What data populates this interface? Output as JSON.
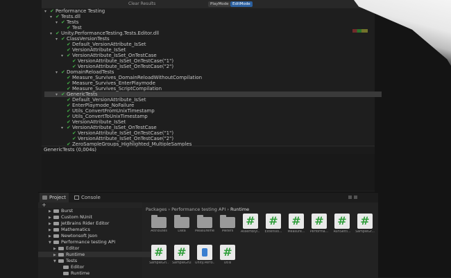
{
  "toolbar": {
    "clear_results": "Clear Results",
    "mode_play": "PlayMode",
    "mode_edit": "EditMode"
  },
  "tests": [
    {
      "label": "Performance Testing",
      "indent": 0,
      "arrow": true,
      "check": true
    },
    {
      "label": "Tests.dll",
      "indent": 1,
      "arrow": true,
      "check": true
    },
    {
      "label": "Tests",
      "indent": 2,
      "arrow": true,
      "check": true
    },
    {
      "label": "Test",
      "indent": 3,
      "arrow": false,
      "check": true
    },
    {
      "label": "Unity.PerformanceTesting.Tests.Editor.dll",
      "indent": 1,
      "arrow": true,
      "check": true
    },
    {
      "label": "ClassVersionTests",
      "indent": 2,
      "arrow": true,
      "check": true
    },
    {
      "label": "Default_VersionAttribute_IsSet",
      "indent": 3,
      "arrow": false,
      "check": true
    },
    {
      "label": "VersionAttribute_IsSet",
      "indent": 3,
      "arrow": false,
      "check": true
    },
    {
      "label": "VersionAttribute_IsSet_OnTestCase",
      "indent": 3,
      "arrow": true,
      "check": true
    },
    {
      "label": "VersionAttribute_IsSet_OnTestCase(\"1\")",
      "indent": 4,
      "arrow": false,
      "check": true
    },
    {
      "label": "VersionAttribute_IsSet_OnTestCase(\"2\")",
      "indent": 4,
      "arrow": false,
      "check": true
    },
    {
      "label": "DomainReloadTests",
      "indent": 2,
      "arrow": true,
      "check": true
    },
    {
      "label": "Measure_Survives_DomainReloadWithoutCompilation",
      "indent": 3,
      "arrow": false,
      "check": true
    },
    {
      "label": "Measure_Survives_EnterPlaymode",
      "indent": 3,
      "arrow": false,
      "check": true
    },
    {
      "label": "Measure_Survives_ScriptCompilation",
      "indent": 3,
      "arrow": false,
      "check": true
    },
    {
      "label": "GenericTests",
      "indent": 2,
      "arrow": true,
      "check": true,
      "selected": true
    },
    {
      "label": "Default_VersionAttribute_IsSet",
      "indent": 3,
      "arrow": false,
      "check": true
    },
    {
      "label": "EnterPlaymode_NoFailure",
      "indent": 3,
      "arrow": false,
      "check": true
    },
    {
      "label": "Utils_ConvertFromUnixTimestamp",
      "indent": 3,
      "arrow": false,
      "check": true
    },
    {
      "label": "Utils_ConvertToUnixTimestamp",
      "indent": 3,
      "arrow": false,
      "check": true
    },
    {
      "label": "VersionAttribute_IsSet",
      "indent": 3,
      "arrow": false,
      "check": true
    },
    {
      "label": "VersionAttribute_IsSet_OnTestCase",
      "indent": 3,
      "arrow": true,
      "check": true
    },
    {
      "label": "VersionAttribute_IsSet_OnTestCase(\"1\")",
      "indent": 4,
      "arrow": false,
      "check": true
    },
    {
      "label": "VersionAttribute_IsSet_OnTestCase(\"2\")",
      "indent": 4,
      "arrow": false,
      "check": true
    },
    {
      "label": "ZeroSampleGroups_Highlighted_MultipleSamples",
      "indent": 3,
      "arrow": false,
      "check": true
    }
  ],
  "status_text": "GenericTests (0,004s)",
  "bottom": {
    "tab_project": "Project",
    "tab_console": "Console",
    "add_label": "+",
    "breadcrumb": {
      "packages": "Packages",
      "package": "Performance testing API",
      "folder": "Runtime",
      "sep": "›"
    },
    "tree": [
      {
        "label": "Burst",
        "indent": 1,
        "arrow": true
      },
      {
        "label": "Custom NUnit",
        "indent": 1,
        "arrow": true
      },
      {
        "label": "JetBrains Rider Editor",
        "indent": 1,
        "arrow": true
      },
      {
        "label": "Mathematics",
        "indent": 1,
        "arrow": true
      },
      {
        "label": "Newtonsoft Json",
        "indent": 1,
        "arrow": true
      },
      {
        "label": "Performance testing API",
        "indent": 1,
        "arrow": true,
        "open": true
      },
      {
        "label": "Editor",
        "indent": 2,
        "arrow": true
      },
      {
        "label": "Runtime",
        "indent": 2,
        "arrow": true,
        "selected": true
      },
      {
        "label": "Tests",
        "indent": 2,
        "arrow": true,
        "open": true
      },
      {
        "label": "Editor",
        "indent": 3,
        "arrow": false
      },
      {
        "label": "Runtime",
        "indent": 3,
        "arrow": false
      }
    ],
    "assets": [
      {
        "label": "Attributes",
        "kind": "folder",
        "icon": "folder-icon"
      },
      {
        "label": "Data",
        "kind": "folder",
        "icon": "folder-icon"
      },
      {
        "label": "Measuremen...",
        "kind": "folder",
        "icon": "folder-icon"
      },
      {
        "label": "Meters",
        "kind": "folder",
        "icon": "folder-icon"
      },
      {
        "label": "AssemblyI...",
        "kind": "cs",
        "icon": "csharp-script-icon"
      },
      {
        "label": "Extensio...",
        "kind": "cs",
        "icon": "csharp-script-icon"
      },
      {
        "label": "Measure...",
        "kind": "cs",
        "icon": "csharp-script-icon"
      },
      {
        "label": "Performa...",
        "kind": "cs",
        "icon": "csharp-script-icon"
      },
      {
        "label": "RunSetti...",
        "kind": "cs",
        "icon": "csharp-script-icon"
      },
      {
        "label": "SampleGr...",
        "kind": "cs",
        "icon": "csharp-script-icon"
      },
      {
        "label": "SampleGrl...",
        "kind": "cs",
        "icon": "csharp-script-icon"
      },
      {
        "label": "SampleGrOp...",
        "kind": "cs",
        "icon": "csharp-script-icon"
      },
      {
        "label": "Unity.Perfo...",
        "kind": "asm",
        "icon": "assembly-definition-icon"
      },
      {
        "label": "Utils",
        "kind": "cs",
        "icon": "csharp-script-icon"
      }
    ]
  },
  "colors": {
    "check": "#43b047",
    "background": "#1b1b1b",
    "accent": "#2b5f9e"
  }
}
